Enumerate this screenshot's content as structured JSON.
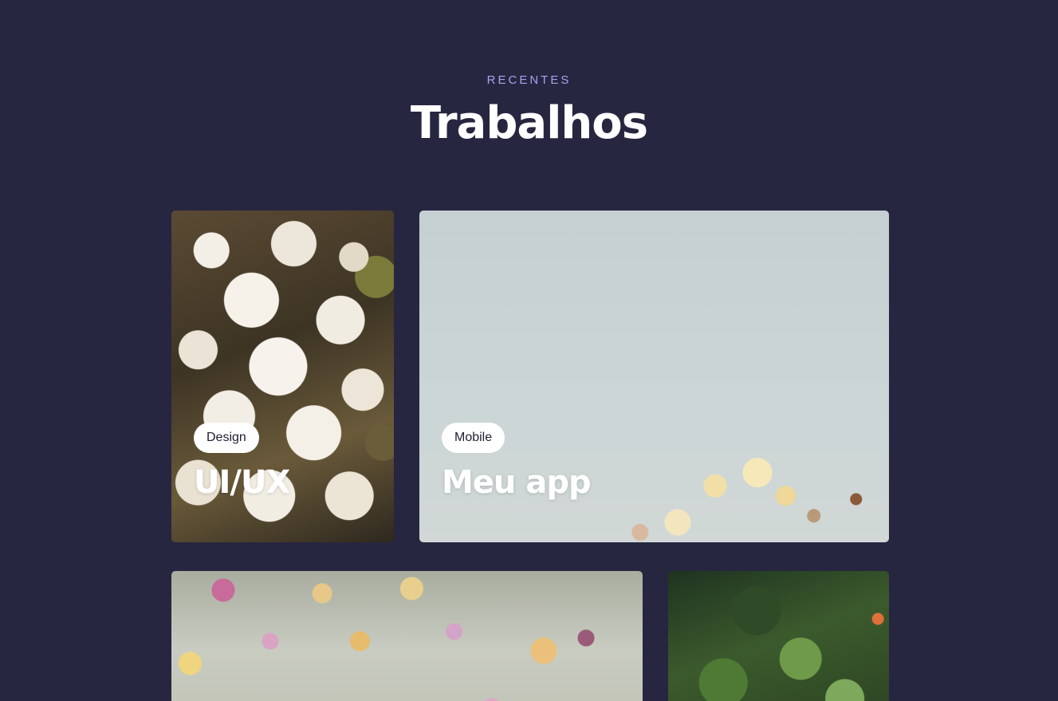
{
  "section": {
    "eyebrow": "RECENTES",
    "title": "Trabalhos"
  },
  "projects": [
    {
      "tag": "Design",
      "title": "UI/UX"
    },
    {
      "tag": "Mobile",
      "title": "Meu app"
    }
  ],
  "colors": {
    "background": "#272640",
    "eyebrow": "#a9a0f0",
    "title": "#ffffff",
    "tag_bg": "#ffffff",
    "tag_text": "#1e1d33"
  }
}
